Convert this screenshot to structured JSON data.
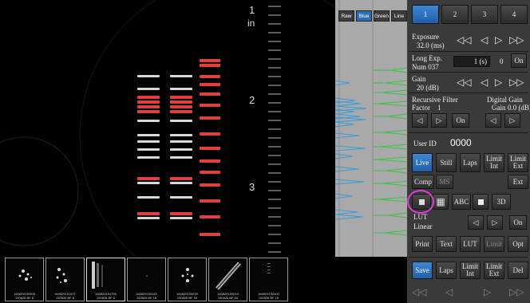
{
  "ruler": {
    "unit": "in",
    "marks": [
      "1",
      "2",
      "3"
    ]
  },
  "profile_tabs": [
    "Raw",
    "Blue",
    "Green",
    "Line"
  ],
  "profile_active_tab": "Blue",
  "thumbnails": [
    {
      "caption": "160829150905\n150826 BF 8"
    },
    {
      "caption": "160829151207\n150826 BF 8"
    },
    {
      "caption": "160829151755\n150826 BF 8"
    },
    {
      "caption": "160829150183\n150826 BF 16"
    },
    {
      "caption": "160829150039\n150826 BF 16"
    },
    {
      "caption": "160829150019\n150826 BF 16"
    },
    {
      "caption": "160829150400\n150826 BF 16"
    }
  ],
  "controls": {
    "tabs": [
      "1",
      "2",
      "3",
      "4"
    ],
    "active_tab": "1",
    "exposure_label": "Exposure",
    "exposure_value": "32.0 (ms)",
    "long_exp_label": "Long Exp.",
    "long_exp_sub": "Num 037",
    "long_exp_field": "1 (s)",
    "long_exp_count": "0",
    "long_exp_toggle": "On",
    "gain_label": "Gain",
    "gain_value": "20 (dB)",
    "recursive_label": "Recursive Filter",
    "recursive_factor_label": "Factor",
    "recursive_factor_value": "1",
    "digital_gain_label": "Digital Gain",
    "digital_gain_sub": "Gain",
    "digital_gain_value": "0.0 (dB)",
    "recursive_toggle": "On",
    "userid_label": "User ID",
    "userid_value": "0000",
    "live": "Live",
    "still": "Still",
    "laps": "Laps",
    "limit_int": "Limit Int",
    "limit_ext": "Limit Ext",
    "comp": "Comp",
    "ms": "MS",
    "ext": "Ext",
    "abc": "ABC",
    "three_d": "3D",
    "lut_label": "LUT",
    "lut_value": "Linear",
    "lut_toggle": "On",
    "print": "Print",
    "text": "Text",
    "lut": "LUT",
    "limit": "Limit",
    "opt": "Opt",
    "save": "Save",
    "save_laps": "Laps",
    "save_limit_int": "Limit Int",
    "save_limit_ext": "Limit Ext",
    "del": "Del"
  }
}
